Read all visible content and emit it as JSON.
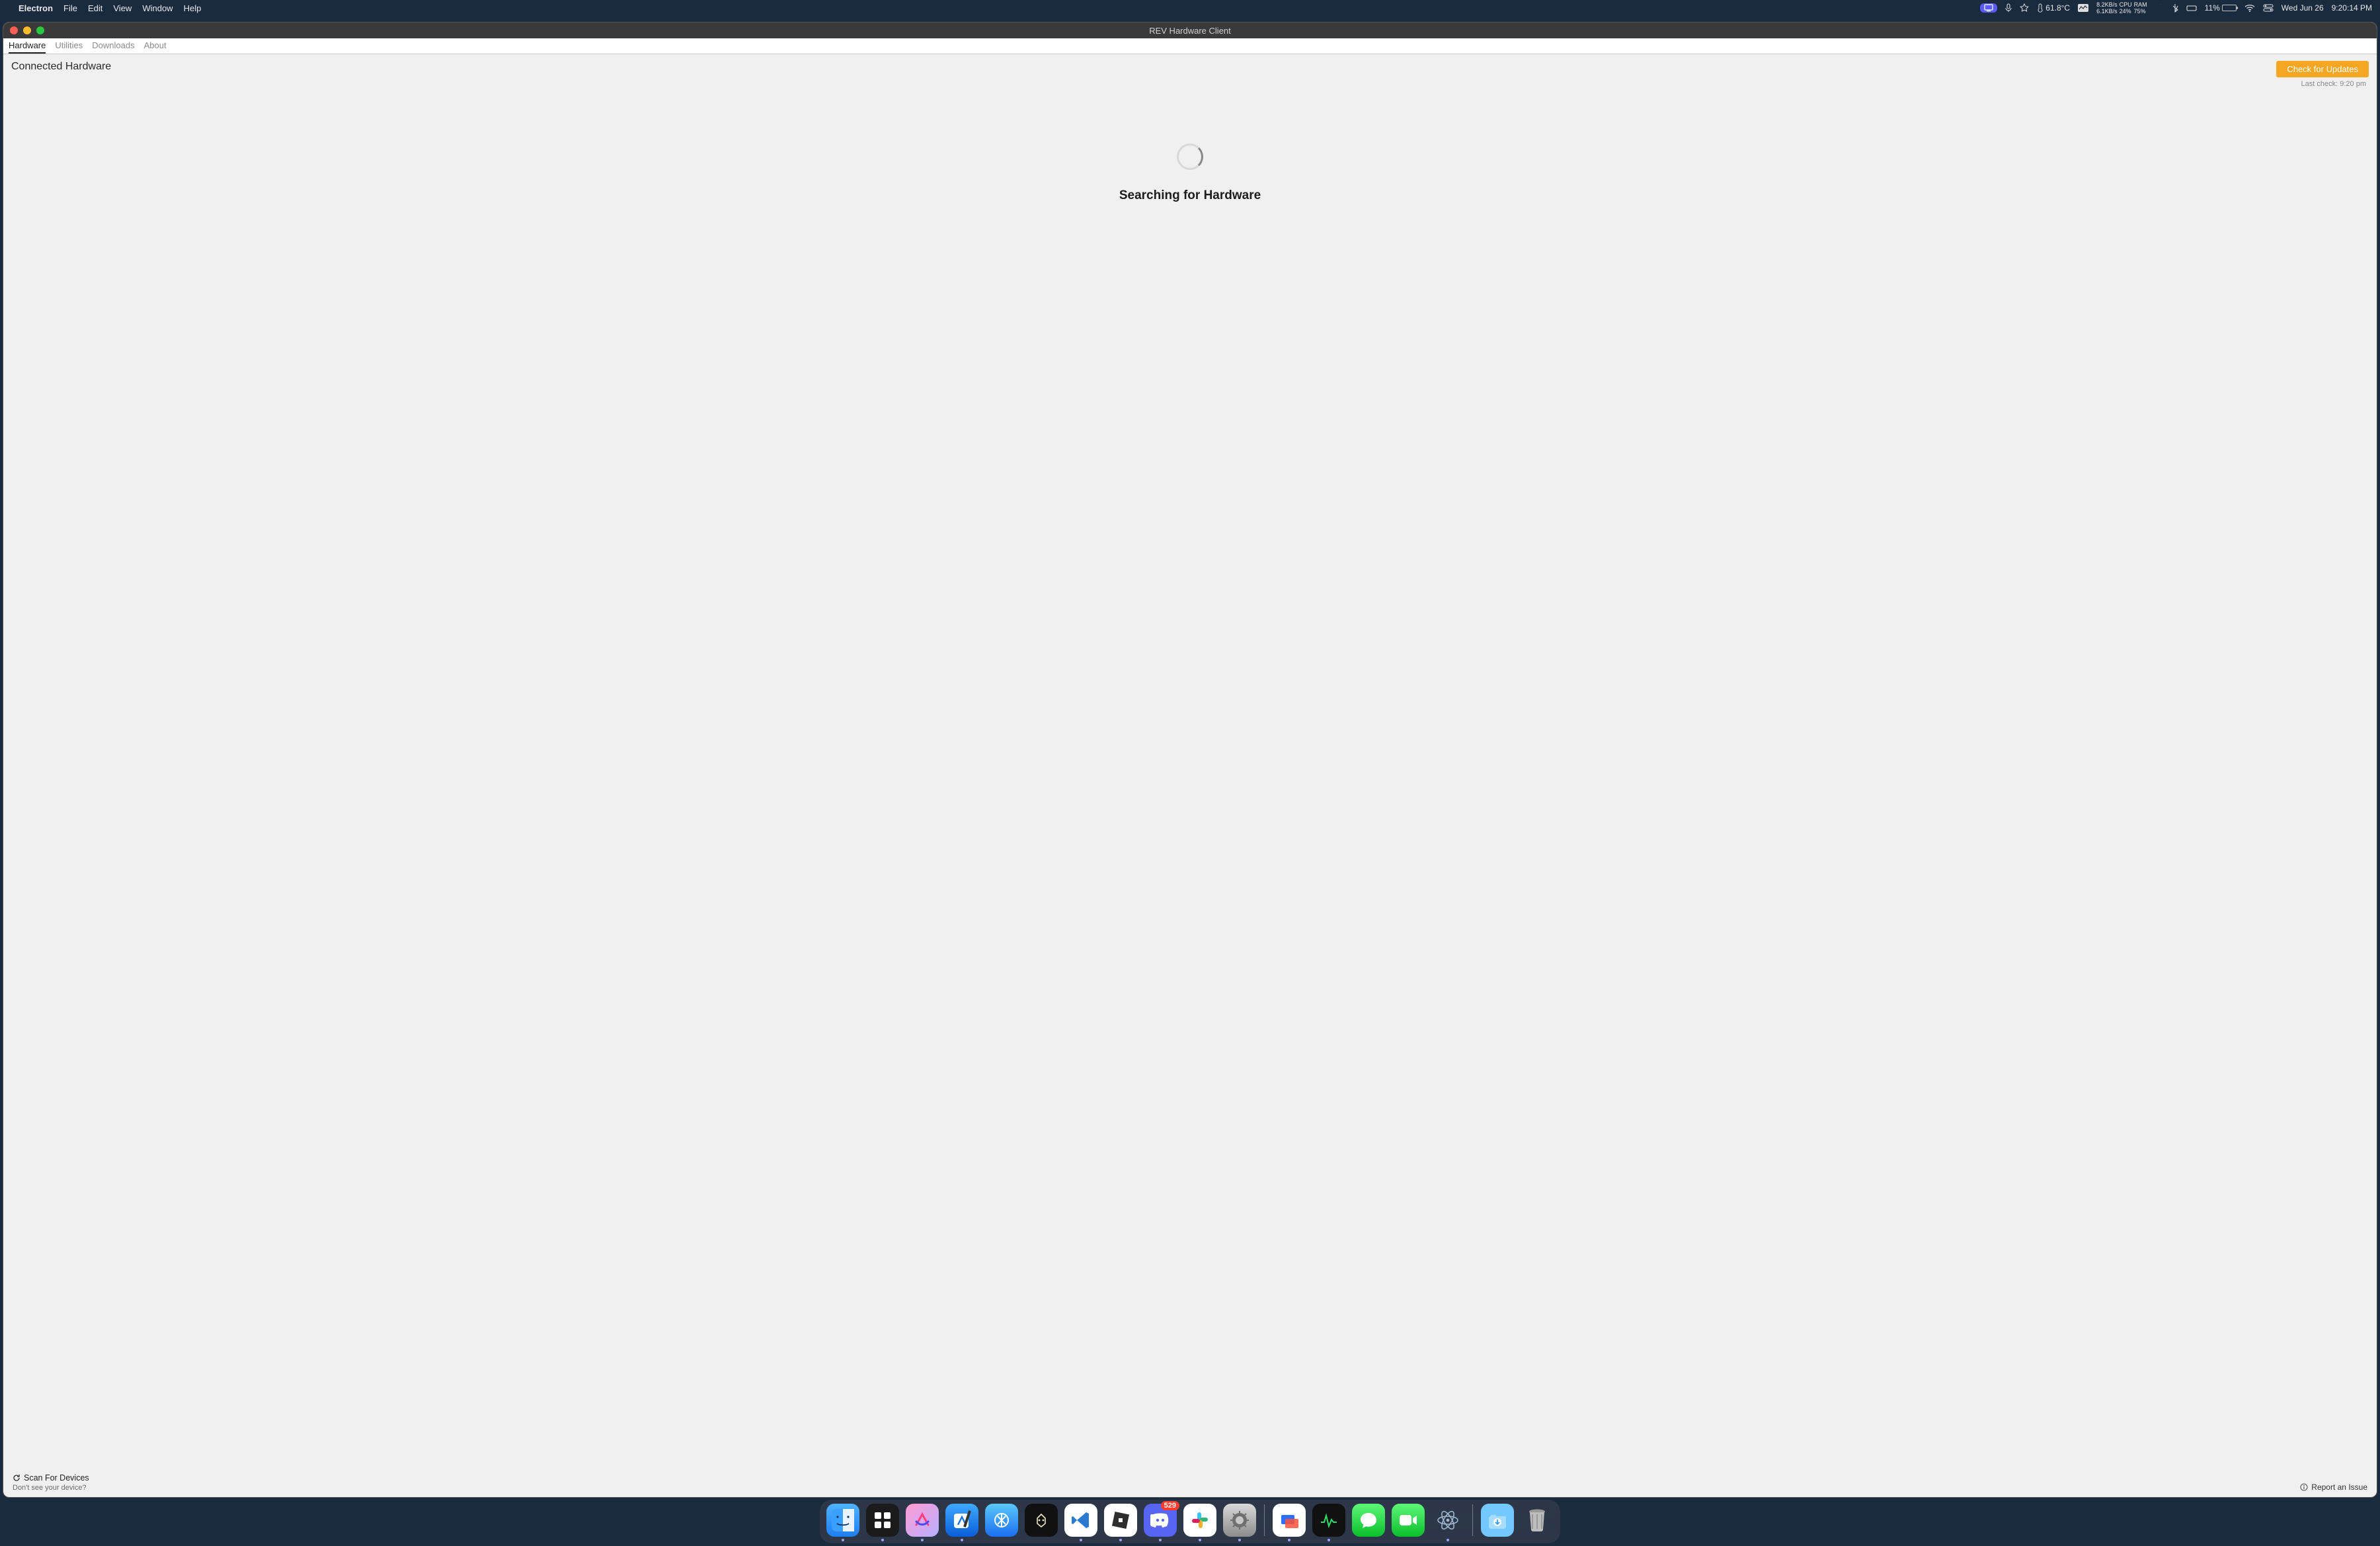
{
  "menubar": {
    "app_name": "Electron",
    "items": [
      "File",
      "Edit",
      "View",
      "Window",
      "Help"
    ],
    "status": {
      "temp": "61.8°C",
      "net_up": "8.2KB/s",
      "net_down": "6.1KB/s",
      "cpu_label": "CPU",
      "cpu_value": "24%",
      "ram_label": "RAM",
      "ram_value": "75%",
      "battery": "11%",
      "date": "Wed Jun 26",
      "time": "9:20:14 PM"
    }
  },
  "window": {
    "title": "REV Hardware Client",
    "tabs": [
      "Hardware",
      "Utilities",
      "Downloads",
      "About"
    ],
    "active_tab_index": 0,
    "page_title": "Connected Hardware",
    "update_button": "Check for Updates",
    "last_check": "Last check: 9:20 pm",
    "searching": "Searching for Hardware",
    "footer": {
      "scan": "Scan For Devices",
      "help": "Don't see your device?",
      "report": "Report an Issue"
    }
  },
  "dock": {
    "discord_badge": "529",
    "apps": [
      "finder",
      "spaces",
      "arc",
      "xcode",
      "appstore",
      "darkreader",
      "vscode",
      "roblox",
      "discord",
      "slack",
      "settings"
    ],
    "apps2": [
      "screens",
      "activity",
      "messages",
      "facetime",
      "electron"
    ],
    "apps3": [
      "downloads",
      "trash"
    ]
  }
}
